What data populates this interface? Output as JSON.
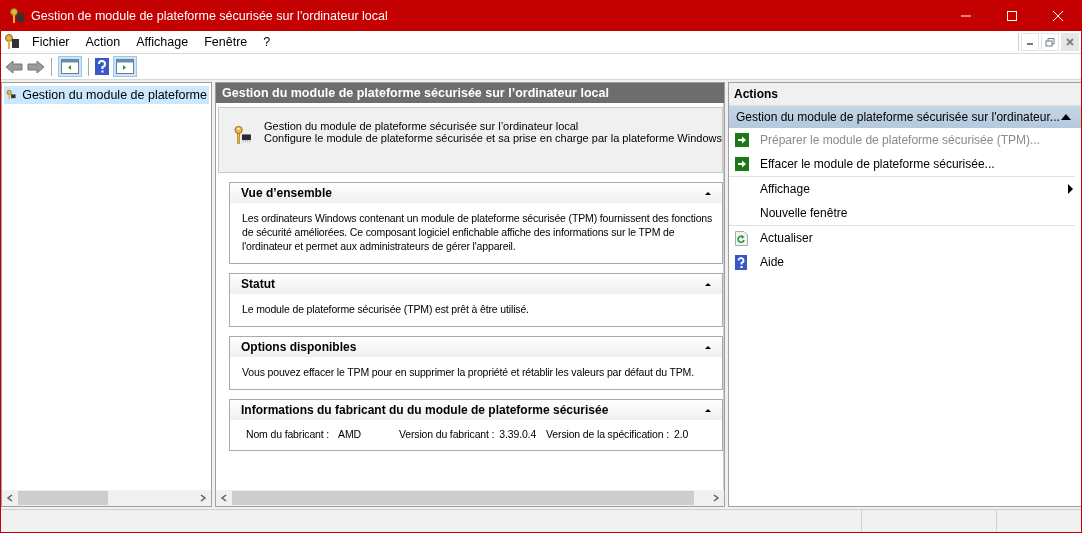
{
  "window": {
    "title": "Gestion de module de plateforme sécurisée sur l'ordinateur local"
  },
  "menu": [
    "Fichier",
    "Action",
    "Affichage",
    "Fenêtre",
    "?"
  ],
  "tree": {
    "items": [
      {
        "label": "Gestion du module de plateforme",
        "selected": true
      }
    ]
  },
  "center": {
    "header": "Gestion du module de plateforme sécurisée sur l’ordinateur local",
    "intro": [
      "Gestion du module de plateforme sécurisée sur l’ordinateur local",
      "Configure le module de plateforme sécurisée et sa prise en charge par la plateforme Windows"
    ],
    "sections": [
      {
        "title": "Vue d’ensemble",
        "expanded": true,
        "kind": "text",
        "text": "Les ordinateurs Windows contenant un module de plateforme sécurisée (TPM) fournissent des fonctions de sécurité améliorées. Ce composant logiciel enfichable affiche des informations sur le TPM de l'ordinateur et permet aux administrateurs de gérer l'appareil."
      },
      {
        "title": "Statut",
        "expanded": true,
        "kind": "text",
        "text": "Le module de plateforme sécurisée (TPM) est prêt à être utilisé."
      },
      {
        "title": "Options disponibles",
        "expanded": true,
        "kind": "text",
        "text": "Vous pouvez effacer le TPM pour en supprimer la propriété et rétablir les valeurs par défaut du TPM."
      },
      {
        "title": "Informations du fabricant du du module de plateforme sécurisée",
        "expanded": true,
        "kind": "fields",
        "fields": [
          {
            "label": "Nom du fabricant :",
            "value": "AMD"
          },
          {
            "label": "Version du fabricant :",
            "value": "3.39.0.4"
          },
          {
            "label": "Version de la spécification :",
            "value": "2.0"
          }
        ]
      }
    ]
  },
  "actions": {
    "title": "Actions",
    "group": "Gestion du module de plateforme sécurisée sur l'ordinateur...",
    "expanded": true,
    "items": [
      {
        "label": "Préparer le module de plateforme sécurisée (TPM)...",
        "kind": "arrow",
        "disabled": true,
        "separated": false,
        "submenu": false
      },
      {
        "label": "Effacer le module de plateforme sécurisée...",
        "kind": "arrow",
        "disabled": false,
        "separated": false,
        "submenu": false
      },
      {
        "label": "Affichage",
        "kind": "none",
        "disabled": false,
        "separated": true,
        "submenu": true
      },
      {
        "label": "Nouvelle fenêtre",
        "kind": "none",
        "disabled": false,
        "separated": false,
        "submenu": false
      },
      {
        "label": "Actualiser",
        "kind": "refresh",
        "disabled": false,
        "separated": true,
        "submenu": false
      },
      {
        "label": "Aide",
        "kind": "help",
        "disabled": false,
        "separated": false,
        "submenu": false
      }
    ]
  }
}
